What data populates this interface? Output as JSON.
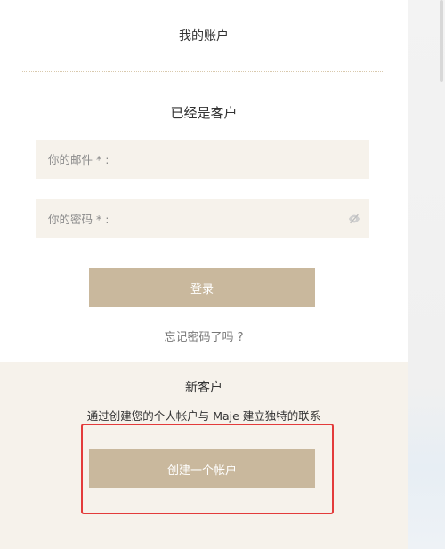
{
  "header": {
    "title": "我的账户"
  },
  "login": {
    "title": "已经是客户",
    "email_placeholder": "你的邮件 * :",
    "password_placeholder": "你的密码 * :",
    "password_toggle_icon": "eye-off-icon",
    "submit_label": "登录",
    "forgot_label": "忘记密码了吗 ?"
  },
  "register": {
    "title": "新客户",
    "description": "通过创建您的个人帐户与 Maje 建立独特的联系",
    "create_label": "创建一个帐户"
  },
  "colors": {
    "accent_button": "#c9b89d",
    "field_background": "#f6f2eb",
    "highlight_border": "#e33b3b"
  }
}
